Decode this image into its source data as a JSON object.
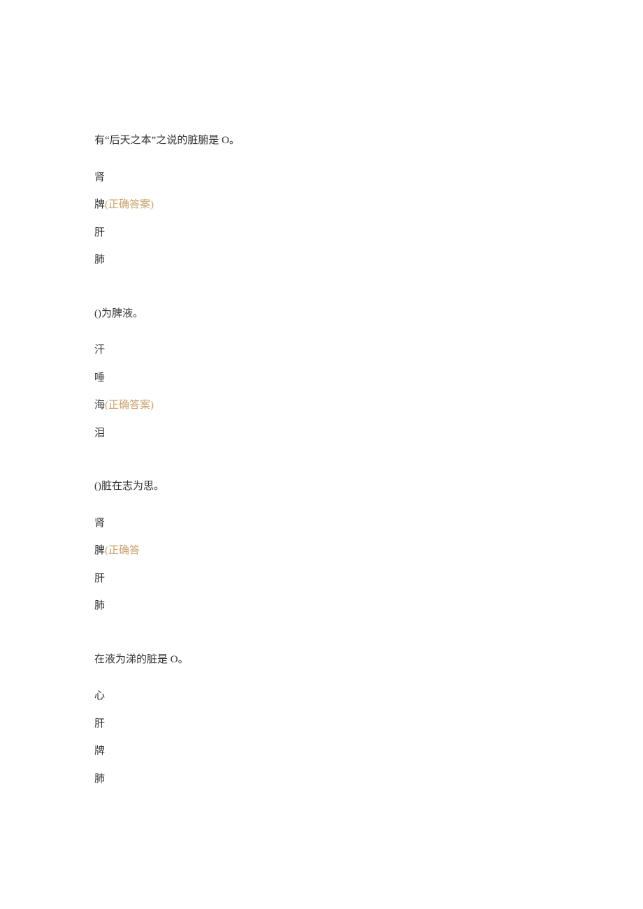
{
  "questions": [
    {
      "prompt": "有“后天之本”之说的脏腑是 O。",
      "options": [
        {
          "text": "肾",
          "correct": false,
          "label": ""
        },
        {
          "text": "牌",
          "correct": true,
          "label": "(正确答案)"
        },
        {
          "text": "肝",
          "correct": false,
          "label": ""
        },
        {
          "text": "肺",
          "correct": false,
          "label": ""
        }
      ]
    },
    {
      "prompt": "()为脾液。",
      "options": [
        {
          "text": "汗",
          "correct": false,
          "label": ""
        },
        {
          "text": "唾",
          "correct": false,
          "label": ""
        },
        {
          "text": "海",
          "correct": true,
          "label": "(正确答案)"
        },
        {
          "text": "泪",
          "correct": false,
          "label": ""
        }
      ]
    },
    {
      "prompt": "()脏在志为思。",
      "options": [
        {
          "text": "肾",
          "correct": false,
          "label": ""
        },
        {
          "text": "脾",
          "correct": true,
          "label": "(正确答"
        },
        {
          "text": "肝",
          "correct": false,
          "label": ""
        },
        {
          "text": "肺",
          "correct": false,
          "label": ""
        }
      ]
    },
    {
      "prompt": "在液为涕的脏是 O。",
      "options": [
        {
          "text": "心",
          "correct": false,
          "label": ""
        },
        {
          "text": "肝",
          "correct": false,
          "label": ""
        },
        {
          "text": "牌",
          "correct": false,
          "label": ""
        },
        {
          "text": "肺",
          "correct": false,
          "label": ""
        }
      ]
    }
  ]
}
